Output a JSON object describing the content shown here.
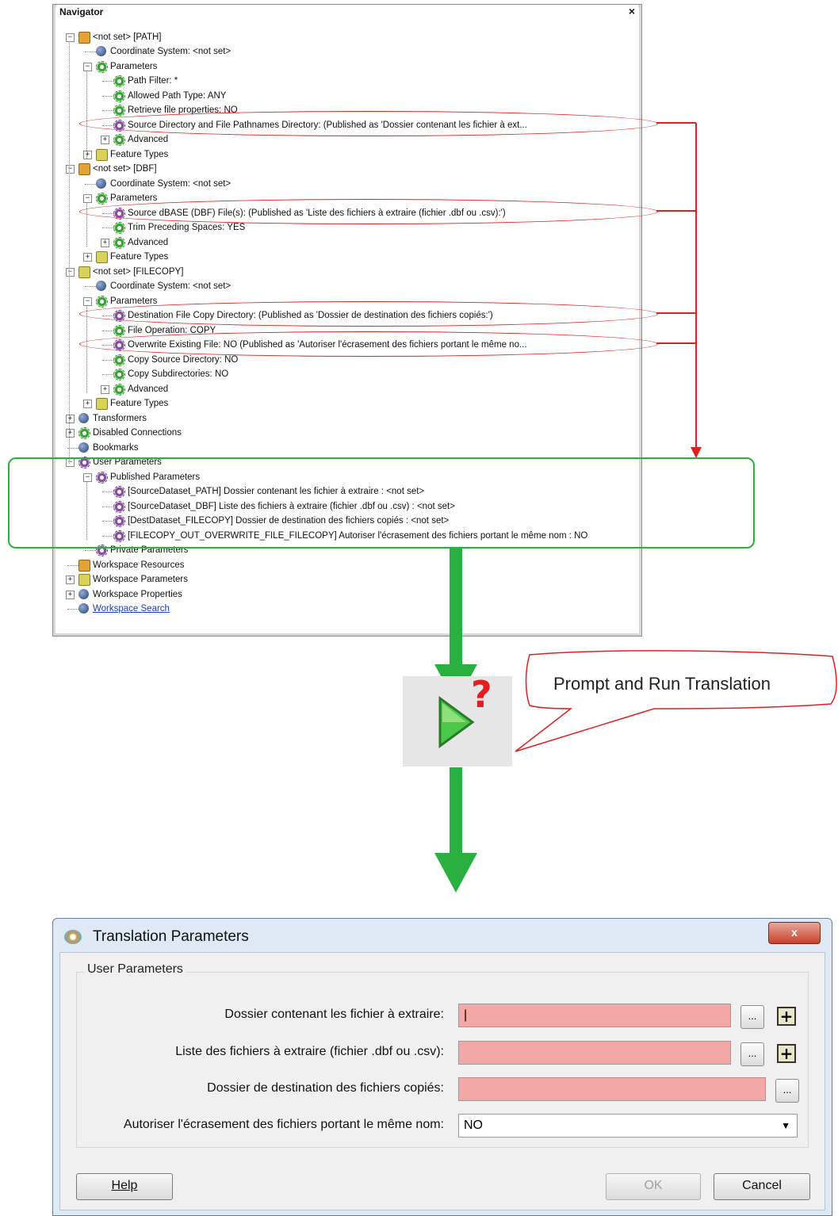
{
  "navigator": {
    "title": "Navigator",
    "close_glyph": "×",
    "rows": [
      "<not set> [PATH]",
      "Coordinate System: <not set>",
      "Parameters",
      "Path Filter: *",
      "Allowed Path Type: ANY",
      "Retrieve file properties: NO",
      "Source Directory and File Pathnames Directory: (Published as 'Dossier contenant les fichier à ext...",
      "Advanced",
      "Feature Types",
      "<not set> [DBF]",
      "Coordinate System: <not set>",
      "Parameters",
      "Source dBASE (DBF) File(s): (Published as 'Liste des fichiers à extraire (fichier .dbf ou .csv):')",
      "Trim Preceding Spaces: YES",
      "Advanced",
      "Feature Types",
      "<not set> [FILECOPY]",
      "Coordinate System: <not set>",
      "Parameters",
      "Destination File Copy Directory: (Published as 'Dossier de destination des fichiers copiés:')",
      "File Operation: COPY",
      "Overwrite Existing File: NO (Published as 'Autoriser l'écrasement des fichiers portant le même no...",
      "Copy Source Directory: NO",
      "Copy Subdirectories: NO",
      "Advanced",
      "Feature Types",
      "Transformers",
      "Disabled Connections",
      "Bookmarks",
      "User Parameters",
      "Published Parameters",
      "[SourceDataset_PATH] Dossier contenant les fichier à extraire : <not set>",
      "[SourceDataset_DBF] Liste des fichiers à extraire (fichier .dbf ou .csv) : <not set>",
      "[DestDataset_FILECOPY] Dossier de destination des fichiers copiés : <not set>",
      "[FILECOPY_OUT_OVERWRITE_FILE_FILECOPY] Autoriser l'écrasement des fichiers portant le même nom : NO",
      "Private Parameters",
      "Workspace Resources",
      "Workspace Parameters",
      "Workspace Properties",
      "Workspace Search"
    ],
    "icons": [
      "reader-icon",
      "globe-icon",
      "gear-icon",
      "gear-icon",
      "gear-icon",
      "gear-icon",
      "published-gear-icon",
      "gear-icon",
      "feature-type-icon",
      "reader-icon",
      "globe-icon",
      "gear-icon",
      "published-gear-icon",
      "gear-icon",
      "gear-icon",
      "feature-type-icon",
      "writer-icon",
      "globe-icon",
      "gear-icon",
      "published-gear-icon",
      "gear-icon",
      "published-gear-icon",
      "gear-icon",
      "gear-icon",
      "gear-icon",
      "feature-type-icon",
      "transformers-icon",
      "disabled-connections-icon",
      "bookmarks-icon",
      "user-parameters-icon",
      "published-gear-icon",
      "published-gear-icon",
      "published-gear-icon",
      "published-gear-icon",
      "published-gear-icon",
      "private-parameters-icon",
      "workspace-resources-icon",
      "workspace-parameters-icon",
      "workspace-properties-icon",
      "binoculars-icon"
    ]
  },
  "callout": {
    "text": "Prompt and Run Translation"
  },
  "run_button": {
    "icon": "prompt-and-run-icon",
    "glyph": "?"
  },
  "colors": {
    "highlight_red": "#e02020",
    "highlight_green": "#2ab040",
    "required_field": "#f4a7a7"
  },
  "dialog": {
    "title": "Translation Parameters",
    "close_glyph": "x",
    "group_label": "User Parameters",
    "fields": [
      {
        "label": "Dossier contenant les fichier à extraire:",
        "value": "|"
      },
      {
        "label": "Liste des fichiers à extraire (fichier .dbf ou .csv):",
        "value": ""
      },
      {
        "label": "Dossier de destination des fichiers copiés:",
        "value": ""
      },
      {
        "label": "Autoriser l'écrasement des fichiers portant le même nom:",
        "value": "NO"
      }
    ],
    "browse_glyph": "...",
    "plus_glyph": "+",
    "dropdown_glyph": "▼",
    "buttons": {
      "help": "Help",
      "ok": "OK",
      "cancel": "Cancel"
    }
  }
}
